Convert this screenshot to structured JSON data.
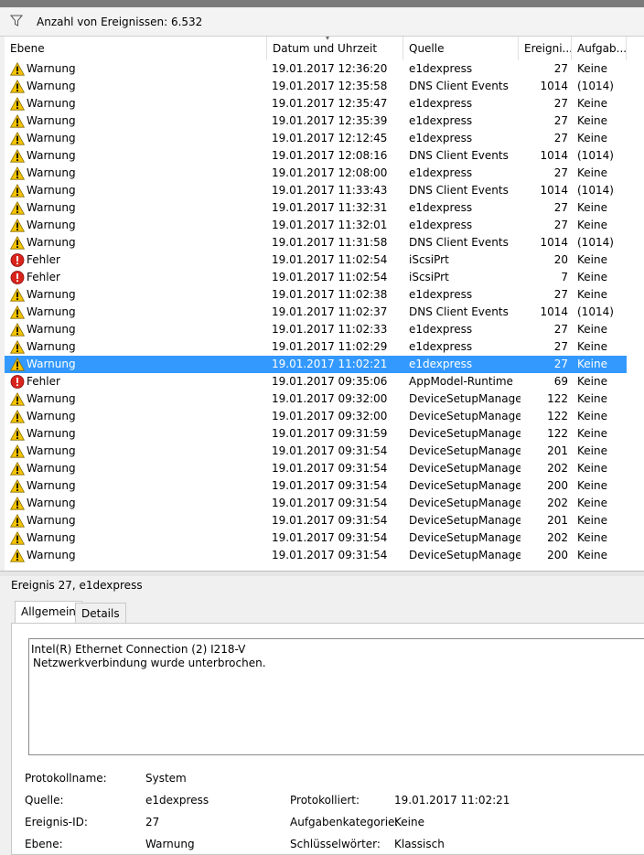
{
  "filter_bar": {
    "count_label": "Anzahl von Ereignissen: 6.532"
  },
  "columns": [
    "Ebene",
    "Datum und Uhrzeit",
    "Quelle",
    "Ereigni...",
    "Aufgab..."
  ],
  "rows": [
    {
      "level": "Warnung",
      "date": "19.01.2017 12:36:20",
      "source": "e1dexpress",
      "id": "27",
      "task": "Keine"
    },
    {
      "level": "Warnung",
      "date": "19.01.2017 12:35:58",
      "source": "DNS Client Events",
      "id": "1014",
      "task": "(1014)"
    },
    {
      "level": "Warnung",
      "date": "19.01.2017 12:35:47",
      "source": "e1dexpress",
      "id": "27",
      "task": "Keine"
    },
    {
      "level": "Warnung",
      "date": "19.01.2017 12:35:39",
      "source": "e1dexpress",
      "id": "27",
      "task": "Keine"
    },
    {
      "level": "Warnung",
      "date": "19.01.2017 12:12:45",
      "source": "e1dexpress",
      "id": "27",
      "task": "Keine"
    },
    {
      "level": "Warnung",
      "date": "19.01.2017 12:08:16",
      "source": "DNS Client Events",
      "id": "1014",
      "task": "(1014)"
    },
    {
      "level": "Warnung",
      "date": "19.01.2017 12:08:00",
      "source": "e1dexpress",
      "id": "27",
      "task": "Keine"
    },
    {
      "level": "Warnung",
      "date": "19.01.2017 11:33:43",
      "source": "DNS Client Events",
      "id": "1014",
      "task": "(1014)"
    },
    {
      "level": "Warnung",
      "date": "19.01.2017 11:32:31",
      "source": "e1dexpress",
      "id": "27",
      "task": "Keine"
    },
    {
      "level": "Warnung",
      "date": "19.01.2017 11:32:01",
      "source": "e1dexpress",
      "id": "27",
      "task": "Keine"
    },
    {
      "level": "Warnung",
      "date": "19.01.2017 11:31:58",
      "source": "DNS Client Events",
      "id": "1014",
      "task": "(1014)"
    },
    {
      "level": "Fehler",
      "date": "19.01.2017 11:02:54",
      "source": "iScsiPrt",
      "id": "20",
      "task": "Keine"
    },
    {
      "level": "Fehler",
      "date": "19.01.2017 11:02:54",
      "source": "iScsiPrt",
      "id": "7",
      "task": "Keine"
    },
    {
      "level": "Warnung",
      "date": "19.01.2017 11:02:38",
      "source": "e1dexpress",
      "id": "27",
      "task": "Keine"
    },
    {
      "level": "Warnung",
      "date": "19.01.2017 11:02:37",
      "source": "DNS Client Events",
      "id": "1014",
      "task": "(1014)"
    },
    {
      "level": "Warnung",
      "date": "19.01.2017 11:02:33",
      "source": "e1dexpress",
      "id": "27",
      "task": "Keine"
    },
    {
      "level": "Warnung",
      "date": "19.01.2017 11:02:29",
      "source": "e1dexpress",
      "id": "27",
      "task": "Keine"
    },
    {
      "level": "Warnung",
      "date": "19.01.2017 11:02:21",
      "source": "e1dexpress",
      "id": "27",
      "task": "Keine",
      "selected": true
    },
    {
      "level": "Fehler",
      "date": "19.01.2017 09:35:06",
      "source": "AppModel-Runtime",
      "id": "69",
      "task": "Keine"
    },
    {
      "level": "Warnung",
      "date": "19.01.2017 09:32:00",
      "source": "DeviceSetupManager",
      "id": "122",
      "task": "Keine"
    },
    {
      "level": "Warnung",
      "date": "19.01.2017 09:32:00",
      "source": "DeviceSetupManager",
      "id": "122",
      "task": "Keine"
    },
    {
      "level": "Warnung",
      "date": "19.01.2017 09:31:59",
      "source": "DeviceSetupManager",
      "id": "122",
      "task": "Keine"
    },
    {
      "level": "Warnung",
      "date": "19.01.2017 09:31:54",
      "source": "DeviceSetupManager",
      "id": "201",
      "task": "Keine"
    },
    {
      "level": "Warnung",
      "date": "19.01.2017 09:31:54",
      "source": "DeviceSetupManager",
      "id": "202",
      "task": "Keine"
    },
    {
      "level": "Warnung",
      "date": "19.01.2017 09:31:54",
      "source": "DeviceSetupManager",
      "id": "200",
      "task": "Keine"
    },
    {
      "level": "Warnung",
      "date": "19.01.2017 09:31:54",
      "source": "DeviceSetupManager",
      "id": "202",
      "task": "Keine"
    },
    {
      "level": "Warnung",
      "date": "19.01.2017 09:31:54",
      "source": "DeviceSetupManager",
      "id": "201",
      "task": "Keine"
    },
    {
      "level": "Warnung",
      "date": "19.01.2017 09:31:54",
      "source": "DeviceSetupManager",
      "id": "202",
      "task": "Keine"
    },
    {
      "level": "Warnung",
      "date": "19.01.2017 09:31:54",
      "source": "DeviceSetupManager",
      "id": "200",
      "task": "Keine"
    }
  ],
  "icons": {
    "warning": "warning-icon",
    "error": "error-icon",
    "filter": "filter-icon"
  },
  "colors": {
    "selection": "#3399ff",
    "warning": "#f5c400",
    "error": "#d9241c"
  },
  "detail": {
    "title": "Ereignis 27, e1dexpress",
    "tabs": [
      "Allgemein",
      "Details"
    ],
    "message_line1": "Intel(R) Ethernet Connection (2) I218-V",
    "message_line2": "Netzwerkverbindung wurde unterbrochen.",
    "props": {
      "log_name_label": "Protokollname:",
      "log_name": "System",
      "source_label": "Quelle:",
      "source": "e1dexpress",
      "logged_label": "Protokolliert:",
      "logged": "19.01.2017 11:02:21",
      "event_id_label": "Ereignis-ID:",
      "event_id": "27",
      "task_category_label": "Aufgabenkategorie:",
      "task_category": "Keine",
      "level_label": "Ebene:",
      "level": "Warnung",
      "keywords_label": "Schlüsselwörter:",
      "keywords": "Klassisch"
    }
  }
}
